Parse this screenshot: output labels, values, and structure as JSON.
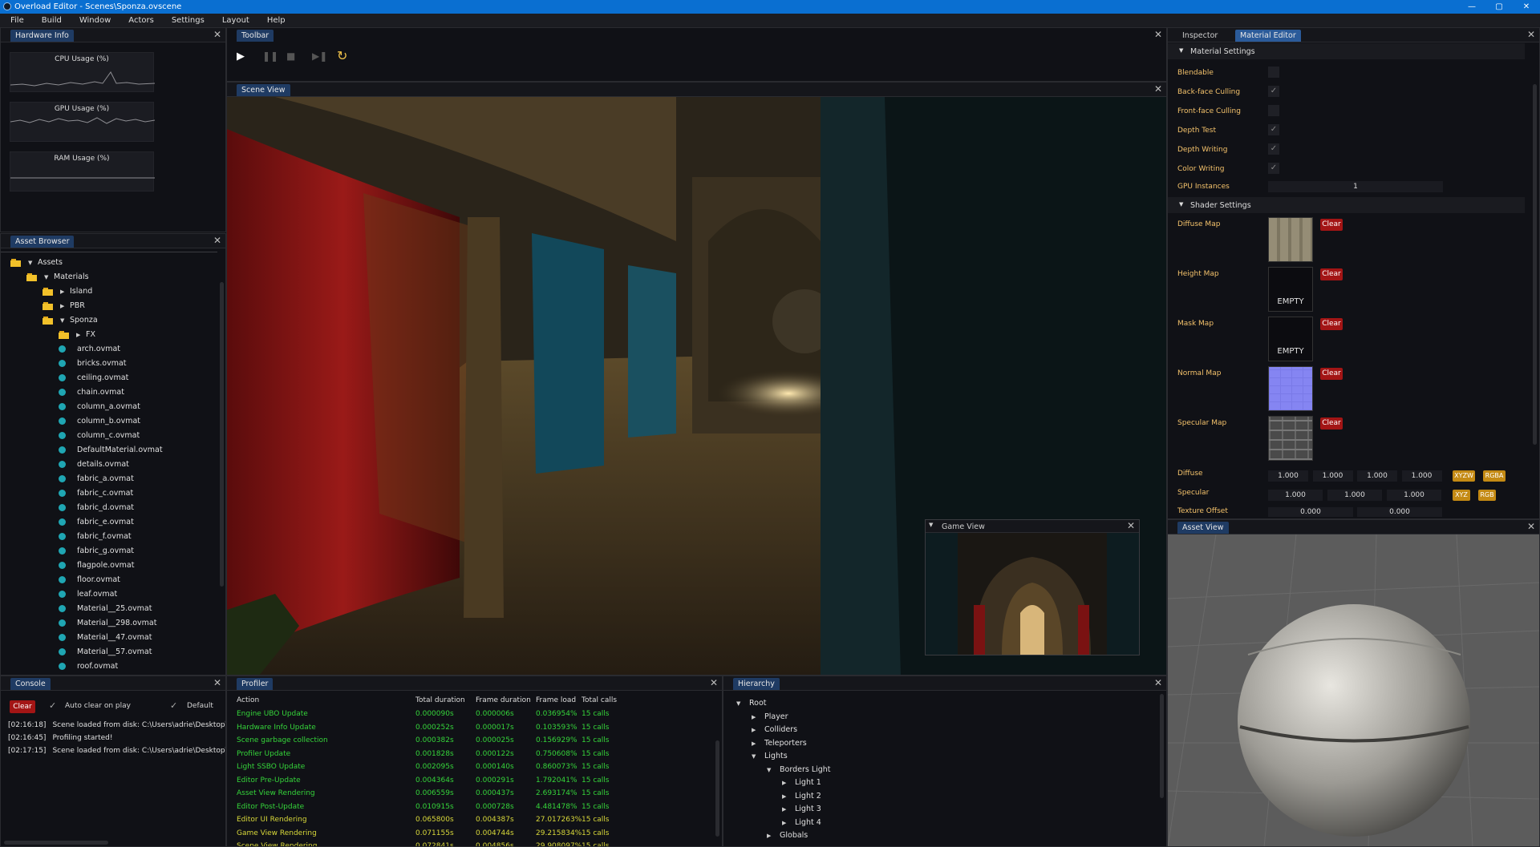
{
  "window": {
    "title": "Overload Editor - Scenes\\Sponza.ovscene",
    "min": "—",
    "max": "▢",
    "close": "✕"
  },
  "menu": [
    "File",
    "Build",
    "Window",
    "Actors",
    "Settings",
    "Layout",
    "Help"
  ],
  "hardware": {
    "tab": "Hardware Info",
    "graphs": [
      "CPU Usage (%)",
      "GPU Usage (%)",
      "RAM Usage (%)"
    ]
  },
  "toolbar": {
    "tab": "Toolbar"
  },
  "scene_view": {
    "tab": "Scene View"
  },
  "game_view": {
    "tab": "Game View"
  },
  "inspector": {
    "tabs": [
      "Inspector",
      "Material Editor"
    ],
    "material_settings": "Material Settings",
    "props": [
      {
        "label": "Blendable",
        "checked": false
      },
      {
        "label": "Back-face Culling",
        "checked": true
      },
      {
        "label": "Front-face Culling",
        "checked": false
      },
      {
        "label": "Depth Test",
        "checked": true
      },
      {
        "label": "Depth Writing",
        "checked": true
      },
      {
        "label": "Color Writing",
        "checked": true
      }
    ],
    "gpu_label": "GPU Instances",
    "gpu_value": "1",
    "shader_settings": "Shader Settings",
    "maps": [
      {
        "label": "Diffuse Map",
        "kind": "diffuse",
        "empty": ""
      },
      {
        "label": "Height Map",
        "kind": "empty",
        "empty": "EMPTY"
      },
      {
        "label": "Mask Map",
        "kind": "empty",
        "empty": "EMPTY"
      },
      {
        "label": "Normal Map",
        "kind": "normal",
        "empty": ""
      },
      {
        "label": "Specular Map",
        "kind": "specular",
        "empty": ""
      }
    ],
    "clear": "Clear",
    "diffuse": {
      "label": "Diffuse",
      "values": [
        "1.000",
        "1.000",
        "1.000",
        "1.000"
      ],
      "btn1": "XYZW",
      "btn2": "RGBA"
    },
    "specular": {
      "label": "Specular",
      "values": [
        "1.000",
        "1.000",
        "1.000"
      ],
      "btn1": "XYZ",
      "btn2": "RGB"
    },
    "texoffset": {
      "label": "Texture Offset",
      "values": [
        "0.000",
        "0.000"
      ]
    }
  },
  "asset_browser": {
    "tab": "Asset Browser",
    "folders": [
      {
        "name": "Assets",
        "open": true
      },
      {
        "name": "Materials",
        "open": true
      },
      {
        "name": "Island",
        "open": false
      },
      {
        "name": "PBR",
        "open": false
      },
      {
        "name": "Sponza",
        "open": true
      },
      {
        "name": "FX",
        "open": false
      }
    ],
    "files": [
      "arch.ovmat",
      "bricks.ovmat",
      "ceiling.ovmat",
      "chain.ovmat",
      "column_a.ovmat",
      "column_b.ovmat",
      "column_c.ovmat",
      "DefaultMaterial.ovmat",
      "details.ovmat",
      "fabric_a.ovmat",
      "fabric_c.ovmat",
      "fabric_d.ovmat",
      "fabric_e.ovmat",
      "fabric_f.ovmat",
      "fabric_g.ovmat",
      "flagpole.ovmat",
      "floor.ovmat",
      "leaf.ovmat",
      "Material__25.ovmat",
      "Material__298.ovmat",
      "Material__47.ovmat",
      "Material__57.ovmat",
      "roof.ovmat"
    ]
  },
  "asset_view": {
    "tab": "Asset View"
  },
  "console": {
    "tab": "Console",
    "clear": "Clear",
    "auto_clear": "Auto clear on play",
    "default": "Default",
    "logs": [
      {
        "time": "[02:16:18]",
        "msg": "Scene loaded from disk: C:\\Users\\adrie\\Desktop\\Ov"
      },
      {
        "time": "[02:16:45]",
        "msg": "Profiling started!"
      },
      {
        "time": "[02:17:15]",
        "msg": "Scene loaded from disk: C:\\Users\\adrie\\Desktop\\Ov"
      }
    ]
  },
  "profiler": {
    "tab": "Profiler",
    "headers": [
      "Action",
      "Total duration",
      "Frame duration",
      "Frame load",
      "Total calls"
    ],
    "rows": [
      {
        "a": "Engine UBO Update",
        "t": "0.000090s",
        "f": "0.000006s",
        "l": "0.036954%",
        "c": "15 calls",
        "color": "#35d43a"
      },
      {
        "a": "Hardware Info Update",
        "t": "0.000252s",
        "f": "0.000017s",
        "l": "0.103593%",
        "c": "15 calls",
        "color": "#35d43a"
      },
      {
        "a": "Scene garbage collection",
        "t": "0.000382s",
        "f": "0.000025s",
        "l": "0.156929%",
        "c": "15 calls",
        "color": "#35d43a"
      },
      {
        "a": "Profiler Update",
        "t": "0.001828s",
        "f": "0.000122s",
        "l": "0.750608%",
        "c": "15 calls",
        "color": "#35d43a"
      },
      {
        "a": "Light SSBO Update",
        "t": "0.002095s",
        "f": "0.000140s",
        "l": "0.860073%",
        "c": "15 calls",
        "color": "#35d43a"
      },
      {
        "a": "Editor Pre-Update",
        "t": "0.004364s",
        "f": "0.000291s",
        "l": "1.792041%",
        "c": "15 calls",
        "color": "#35d43a"
      },
      {
        "a": "Asset View Rendering",
        "t": "0.006559s",
        "f": "0.000437s",
        "l": "2.693174%",
        "c": "15 calls",
        "color": "#35d43a"
      },
      {
        "a": "Editor Post-Update",
        "t": "0.010915s",
        "f": "0.000728s",
        "l": "4.481478%",
        "c": "15 calls",
        "color": "#35d43a"
      },
      {
        "a": "Editor UI Rendering",
        "t": "0.065800s",
        "f": "0.004387s",
        "l": "27.017263%",
        "c": "15 calls",
        "color": "#d8d83a"
      },
      {
        "a": "Game View Rendering",
        "t": "0.071155s",
        "f": "0.004744s",
        "l": "29.215834%",
        "c": "15 calls",
        "color": "#d8d83a"
      },
      {
        "a": "Scene View Rendering",
        "t": "0.072841s",
        "f": "0.004856s",
        "l": "29.908097%",
        "c": "15 calls",
        "color": "#d8d83a"
      }
    ]
  },
  "hierarchy": {
    "tab": "Hierarchy",
    "items": [
      {
        "name": "Root",
        "depth": 0,
        "open": true
      },
      {
        "name": "Player",
        "depth": 1,
        "open": false
      },
      {
        "name": "Colliders",
        "depth": 1,
        "open": false
      },
      {
        "name": "Teleporters",
        "depth": 1,
        "open": false
      },
      {
        "name": "Lights",
        "depth": 1,
        "open": true
      },
      {
        "name": "Borders Light",
        "depth": 2,
        "open": true
      },
      {
        "name": "Light 1",
        "depth": 3,
        "open": false
      },
      {
        "name": "Light 2",
        "depth": 3,
        "open": false
      },
      {
        "name": "Light 3",
        "depth": 3,
        "open": false
      },
      {
        "name": "Light 4",
        "depth": 3,
        "open": false
      },
      {
        "name": "Globals",
        "depth": 2,
        "open": false
      }
    ]
  }
}
